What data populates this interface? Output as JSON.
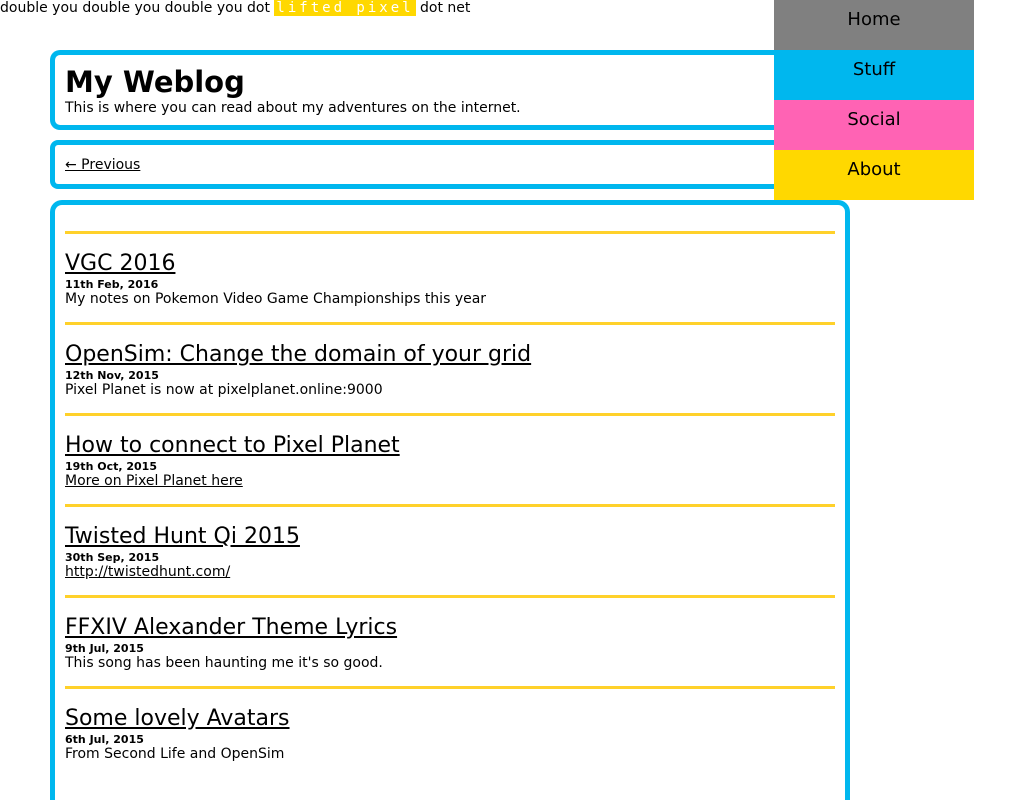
{
  "topline": {
    "pre": "double you double you double you dot",
    "brand": "lifted pixel",
    "post": "dot net"
  },
  "header": {
    "title": "My Weblog",
    "subtitle": "This is where you can read about my adventures on the internet."
  },
  "pager": {
    "previous": "← Previous"
  },
  "nav": {
    "items": [
      {
        "label": "Home",
        "color": "#808080"
      },
      {
        "label": "Stuff",
        "color": "#00b7ee"
      },
      {
        "label": "Social",
        "color": "#ff63b4"
      },
      {
        "label": "About",
        "color": "#ffd800"
      }
    ]
  },
  "posts": [
    {
      "title": "VGC 2016",
      "date": "11th Feb, 2016",
      "summary": "My notes on Pokemon Video Game Championships this year",
      "link": false
    },
    {
      "title": "OpenSim: Change the domain of your grid",
      "date": "12th Nov, 2015",
      "summary": "Pixel Planet is now at pixelplanet.online:9000",
      "link": false
    },
    {
      "title": "How to connect to Pixel Planet",
      "date": "19th Oct, 2015",
      "summary": "More on Pixel Planet here",
      "link": true
    },
    {
      "title": "Twisted Hunt Qi 2015",
      "date": "30th Sep, 2015",
      "summary": "http://twistedhunt.com/",
      "link": true
    },
    {
      "title": "FFXIV Alexander Theme Lyrics",
      "date": "9th Jul, 2015",
      "summary": "This song has been haunting me it's so good.",
      "link": false
    },
    {
      "title": "Some lovely Avatars",
      "date": "6th Jul, 2015",
      "summary": "From Second Life and OpenSim",
      "link": false
    }
  ]
}
